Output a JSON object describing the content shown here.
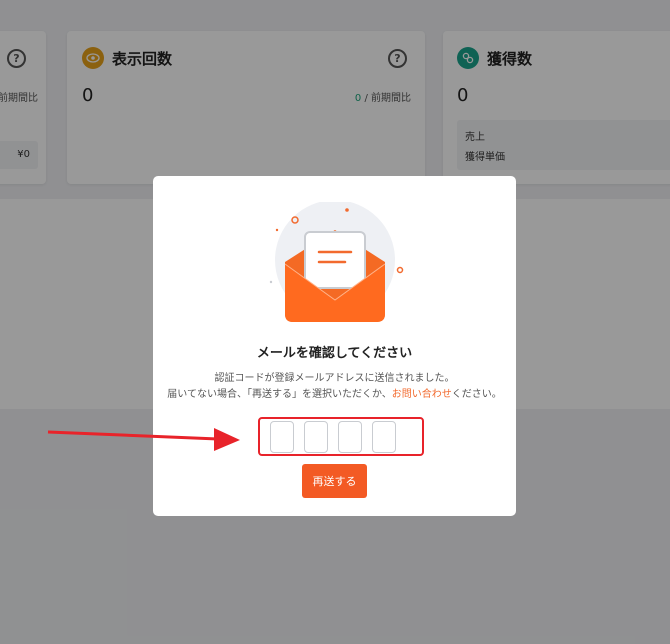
{
  "cards": [
    {
      "compare_label": "前期間比",
      "subvalue": "¥0"
    },
    {
      "title": "表示回数",
      "value": "0",
      "compare_value": "0",
      "compare_label": "/ 前期間比"
    },
    {
      "title": "獲得数",
      "value": "0",
      "sub_rows": [
        "売上",
        "獲得単価"
      ]
    }
  ],
  "modal": {
    "title": "メールを確認してください",
    "message_line1": "認証コードが登録メールアドレスに送信されました。",
    "message_line2_before": "届いてない場合、「再送する」を選択いただくか、",
    "message_link": "お問い合わせ",
    "message_line2_after": "ください。",
    "code_boxes": [
      "",
      "",
      "",
      ""
    ],
    "resend_label": "再送する"
  },
  "colors": {
    "accent": "#f35a24",
    "highlight": "#e8232a",
    "card_icon_views": "#e8a21a",
    "card_icon_acquisitions": "#1aa38c"
  },
  "icons": {
    "views": "eye-icon",
    "acquisitions": "link-icon",
    "help": "question-icon",
    "envelope": "envelope-icon"
  }
}
